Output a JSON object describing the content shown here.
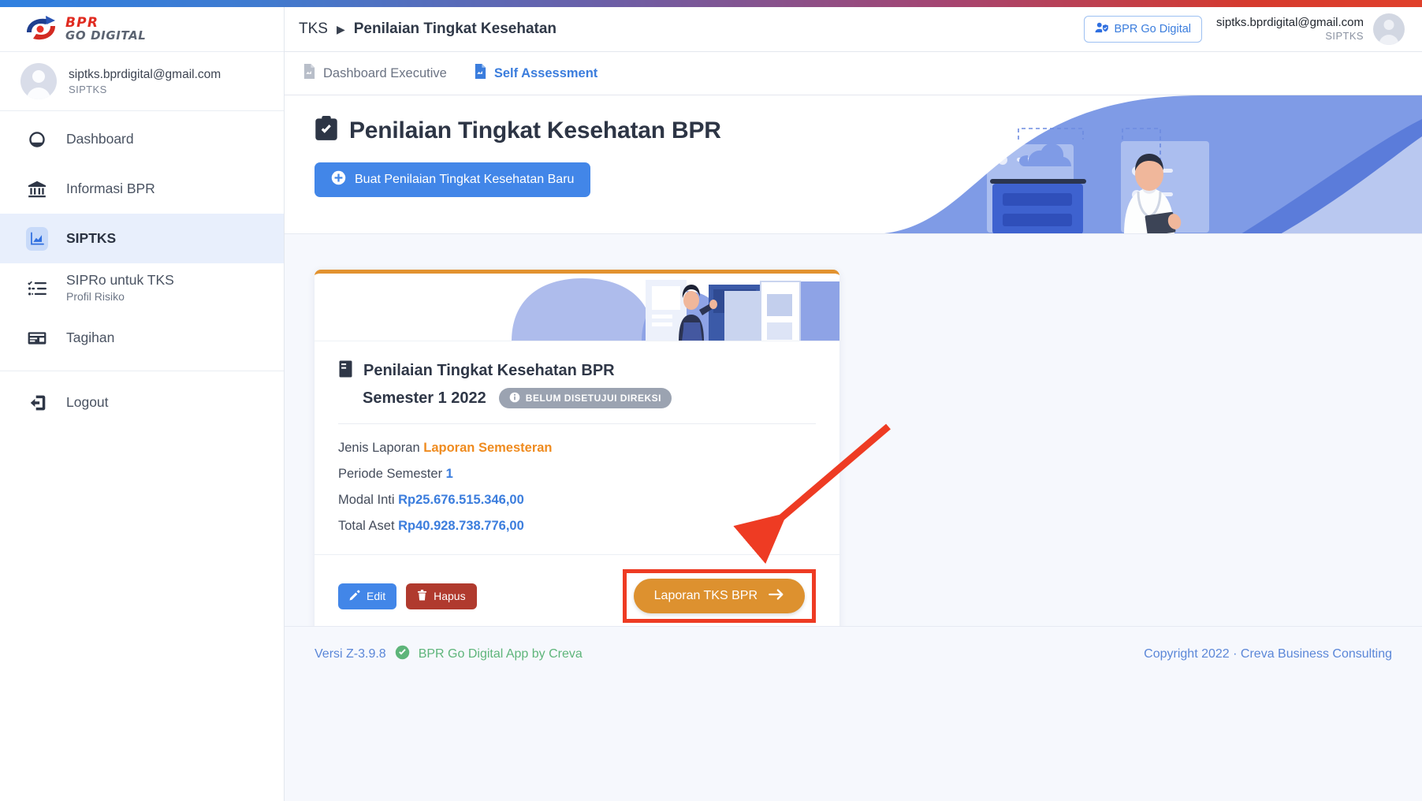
{
  "brand": {
    "line1": "BPR",
    "line2": "GO DIGITAL"
  },
  "sidebar": {
    "profile": {
      "email": "siptks.bprdigital@gmail.com",
      "role": "SIPTKS"
    },
    "items": [
      {
        "label": "Dashboard",
        "icon": "speedometer-icon",
        "sub": ""
      },
      {
        "label": "Informasi BPR",
        "icon": "bank-icon",
        "sub": ""
      },
      {
        "label": "SIPTKS",
        "icon": "chart-icon",
        "sub": "",
        "active": true
      },
      {
        "label": "SIPRo untuk TKS",
        "icon": "checklist-icon",
        "sub": "Profil Risiko"
      },
      {
        "label": "Tagihan",
        "icon": "invoice-icon",
        "sub": ""
      }
    ],
    "logout": {
      "label": "Logout",
      "icon": "sign-out-icon"
    }
  },
  "header": {
    "breadcrumb_root": "TKS",
    "breadcrumb_current": "Penilaian Tingkat Kesehatan",
    "go_digital_button": "BPR Go Digital",
    "user": {
      "email": "siptks.bprdigital@gmail.com",
      "role": "SIPTKS"
    }
  },
  "tabs": [
    {
      "label": "Dashboard Executive",
      "active": false
    },
    {
      "label": "Self Assessment",
      "active": true
    }
  ],
  "main": {
    "title": "Penilaian Tingkat Kesehatan BPR",
    "create_button": "Buat Penilaian Tingkat Kesehatan Baru"
  },
  "card": {
    "title": "Penilaian Tingkat Kesehatan BPR",
    "subtitle": "Semester 1 2022",
    "badge": "BELUM DISETUJUI DIREKSI",
    "facts": [
      {
        "label": "Jenis Laporan",
        "value": "Laporan Semesteran",
        "color": "orange"
      },
      {
        "label": "Periode Semester",
        "value": "1",
        "color": "blue"
      },
      {
        "label": "Modal Inti",
        "value": "Rp25.676.515.346,00",
        "color": "blue"
      },
      {
        "label": "Total Aset",
        "value": "Rp40.928.738.776,00",
        "color": "blue"
      }
    ],
    "edit_button": "Edit",
    "delete_button": "Hapus",
    "report_button": "Laporan TKS BPR"
  },
  "footer": {
    "version": "Versi Z-3.9.8",
    "app_name": "BPR Go Digital App by Creva",
    "copyright": "Copyright 2022 · Creva Business Consulting"
  },
  "colors": {
    "accent_blue": "#4286e8",
    "accent_orange": "#dd912f",
    "danger_red": "#b03a2e",
    "annotation_red": "#ee3b23",
    "badge_gray": "#9ba3b1"
  }
}
